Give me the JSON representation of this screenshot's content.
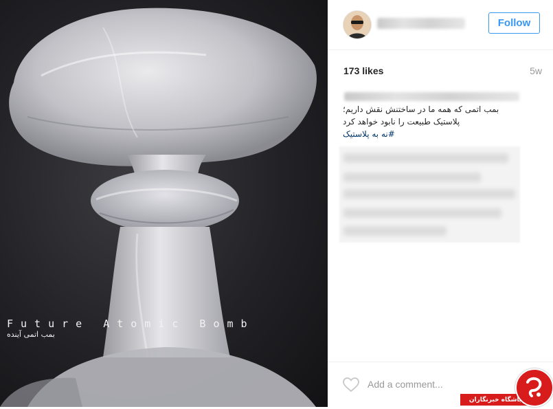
{
  "post": {
    "image": {
      "caption_en": "Future Atomic Bomb",
      "caption_fa": "بمب اتمی آینده"
    },
    "header": {
      "follow_label": "Follow"
    },
    "likes_text": "173 likes",
    "age_text": "5w",
    "caption": {
      "line1": "بمب اتمی که همه ما در ساختنش نقش داریم؛",
      "line2": "پلاستیک طبیعت را نابود خواهد کرد",
      "hashtag": "#نه به پلاستیک"
    },
    "comment": {
      "placeholder": "Add a comment..."
    }
  },
  "watermark": {
    "text": "باشگاه خبرنگاران"
  },
  "colors": {
    "accent": "#3897f0",
    "hashtag": "#003569",
    "watermark_red": "#d81b1b"
  },
  "icons": [
    "heart-icon",
    "avatar"
  ]
}
